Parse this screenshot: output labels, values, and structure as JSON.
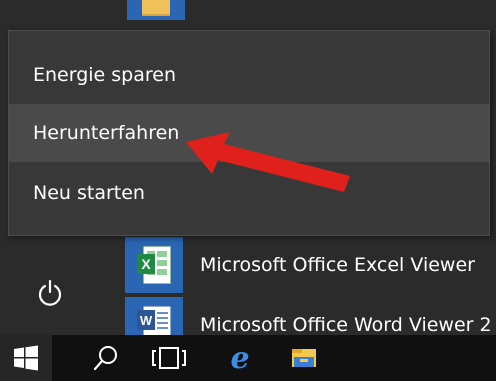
{
  "power_menu": {
    "items": [
      {
        "label": "Energie sparen"
      },
      {
        "label": "Herunterfahren"
      },
      {
        "label": "Neu starten"
      }
    ]
  },
  "apps": [
    {
      "label": "Microsoft Office Excel Viewer",
      "icon": "excel-icon"
    },
    {
      "label": "Microsoft Office Word Viewer 2",
      "icon": "word-icon"
    }
  ],
  "taskbar": {
    "items": [
      "windows-start-icon",
      "search-icon",
      "task-view-icon",
      "edge-icon",
      "file-explorer-icon"
    ]
  },
  "colors": {
    "menu_background": "#383838",
    "highlight": "#4a4a4a",
    "tile_blue": "#2a66b4",
    "arrow_red": "#e0201b"
  }
}
